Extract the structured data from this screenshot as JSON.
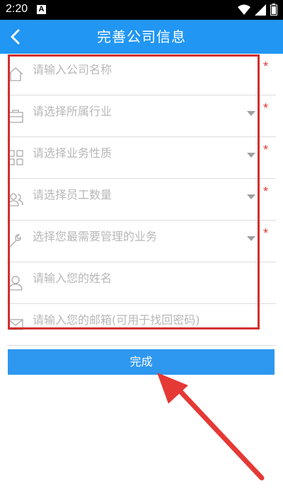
{
  "status_bar": {
    "time": "2:20",
    "notification_letter": "A"
  },
  "header": {
    "title": "完善公司信息"
  },
  "form": {
    "fields": [
      {
        "placeholder": "请输入公司名称",
        "icon": "home-icon",
        "dropdown": false,
        "required": true,
        "required_mark": "*"
      },
      {
        "placeholder": "请选择所属行业",
        "icon": "briefcase-icon",
        "dropdown": true,
        "required": true,
        "required_mark": "*"
      },
      {
        "placeholder": "请选择业务性质",
        "icon": "grid-icon",
        "dropdown": true,
        "required": true,
        "required_mark": "*"
      },
      {
        "placeholder": "请选择员工数量",
        "icon": "people-icon",
        "dropdown": true,
        "required": true,
        "required_mark": "*"
      },
      {
        "placeholder": "选择您最需要管理的业务",
        "icon": "wrench-icon",
        "dropdown": true,
        "required": true,
        "required_mark": "*"
      },
      {
        "placeholder": "请输入您的姓名",
        "icon": "person-icon",
        "dropdown": false,
        "required": false
      },
      {
        "placeholder": "请输入您的邮箱(可用于找回密码)",
        "icon": "mail-icon",
        "dropdown": false,
        "required": false
      }
    ]
  },
  "submit": {
    "label": "完成"
  },
  "colors": {
    "primary": "#2196F3",
    "button": "#2E97F0",
    "required": "#e53935",
    "annotation": "#d32f2f",
    "placeholder": "#b8b8b8"
  }
}
